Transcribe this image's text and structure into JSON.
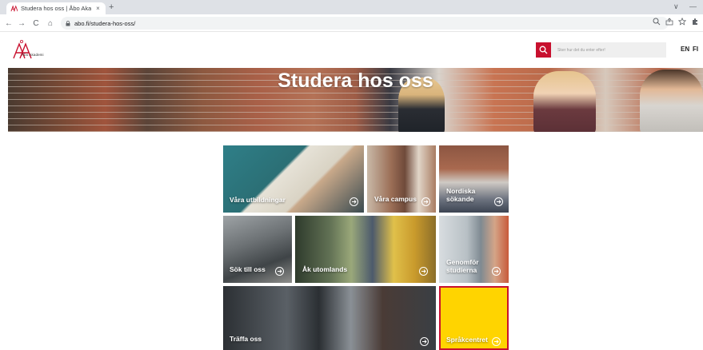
{
  "browser": {
    "tab_title": "Studera hos oss | Åbo Akademi",
    "tab_close": "×",
    "new_tab": "+",
    "url": "abo.fi/studera-hos-oss/",
    "nav": {
      "back": "←",
      "forward": "→",
      "reload": "C",
      "home": "⌂"
    },
    "window_controls": {
      "collapse": "∨",
      "minimize": "—"
    },
    "icons": [
      "zoom-icon",
      "share-icon",
      "star-icon",
      "extensions-icon"
    ]
  },
  "site": {
    "logo_text": "Åbo Akademi",
    "search_placeholder": "Sker hur det du enter efter!",
    "lang_en": "EN",
    "lang_fi": "FI",
    "accent_color": "#c8102e"
  },
  "hero": {
    "title": "Studera hos oss"
  },
  "tiles": [
    {
      "label": "Våra utbildningar"
    },
    {
      "label": "Våra campus"
    },
    {
      "label": "Nordiska sökande"
    },
    {
      "label": "Sök till oss"
    },
    {
      "label": "Åk utomlands"
    },
    {
      "label": "Genomför studierna"
    },
    {
      "label": "Träffa oss"
    },
    {
      "label": "Språkcentret",
      "color": "#ffd400"
    }
  ]
}
